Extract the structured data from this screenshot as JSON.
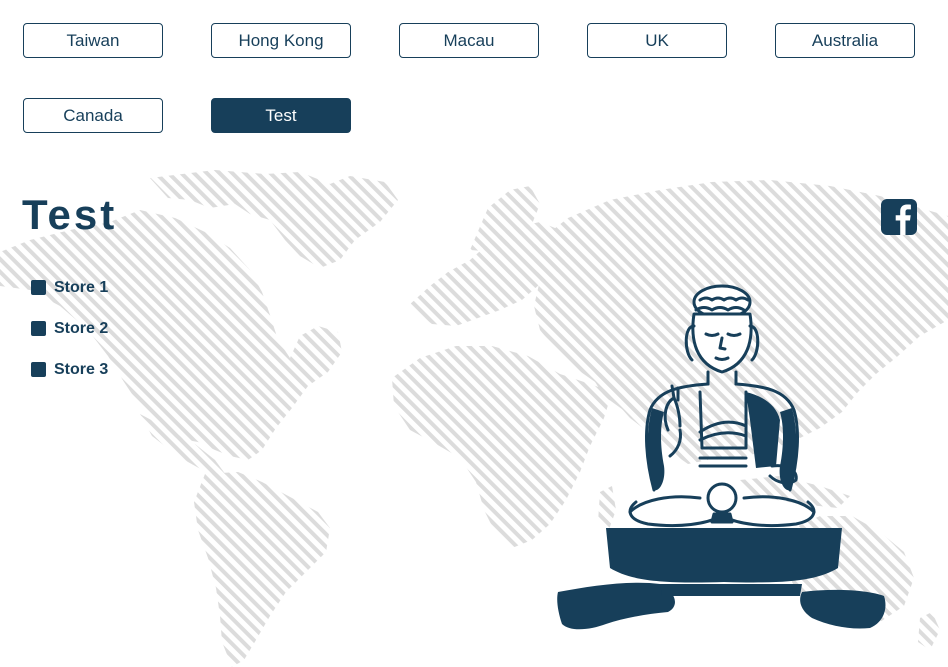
{
  "regions": [
    {
      "label": "Taiwan",
      "active": false
    },
    {
      "label": "Hong Kong",
      "active": false
    },
    {
      "label": "Macau",
      "active": false
    },
    {
      "label": "UK",
      "active": false
    },
    {
      "label": "Australia",
      "active": false
    },
    {
      "label": "Canada",
      "active": false
    },
    {
      "label": "Test",
      "active": true
    }
  ],
  "page": {
    "title": "Test"
  },
  "stores": [
    {
      "label": "Store 1"
    },
    {
      "label": "Store 2"
    },
    {
      "label": "Store 3"
    }
  ],
  "icons": {
    "social": "facebook-icon",
    "background": "world-map",
    "illustration": "buddha-statue"
  },
  "colors": {
    "primary": "#173f5a",
    "map_hatch": "#d8d8d8",
    "background": "#ffffff"
  }
}
